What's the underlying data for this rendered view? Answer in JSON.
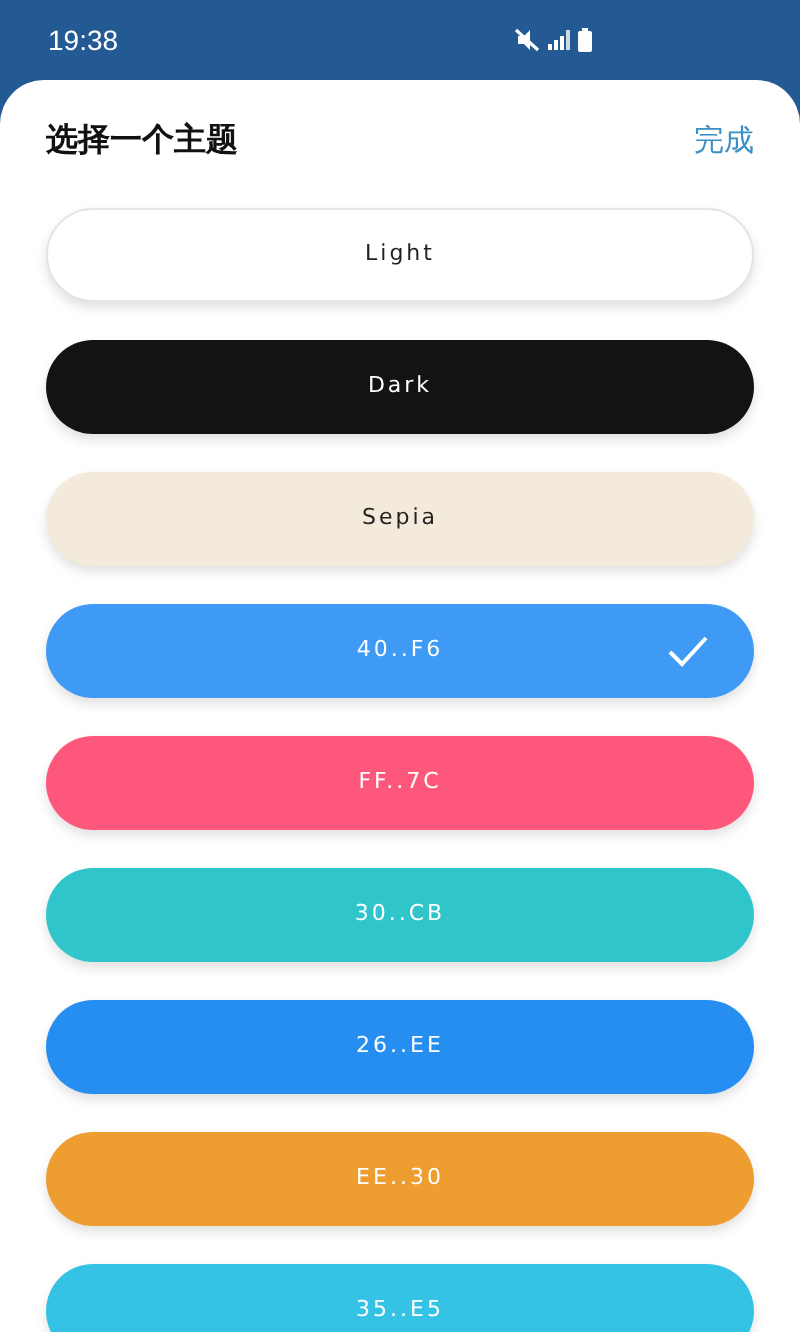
{
  "status_bar": {
    "time": "19:38"
  },
  "sheet": {
    "title": "选择一个主题",
    "done": "完成"
  },
  "themes": [
    {
      "label": "Light",
      "color": "#ffffff",
      "selected": false
    },
    {
      "label": "Dark",
      "color": "#131313",
      "selected": false
    },
    {
      "label": "Sepia",
      "color": "#f3eadb",
      "selected": false
    },
    {
      "label": "40..F6",
      "color": "#3e9af5",
      "selected": true
    },
    {
      "label": "FF..7C",
      "color": "#fd587c",
      "selected": false
    },
    {
      "label": "30..CB",
      "color": "#30c5cb",
      "selected": false
    },
    {
      "label": "26..EE",
      "color": "#268ef0",
      "selected": false
    },
    {
      "label": "EE..30",
      "color": "#ee9e30",
      "selected": false
    },
    {
      "label": "35..E5",
      "color": "#35c3e5",
      "selected": false
    }
  ]
}
